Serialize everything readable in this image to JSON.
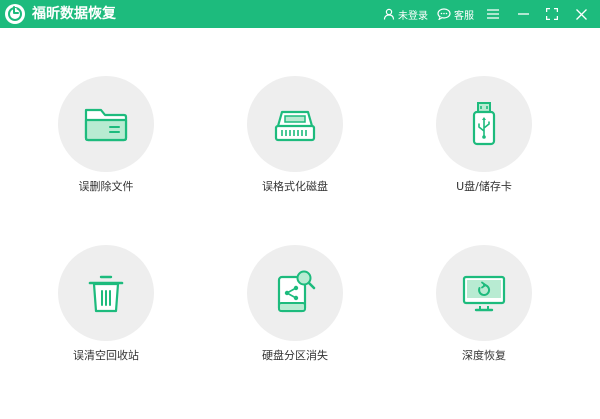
{
  "titlebar": {
    "app_title": "福昕数据恢复",
    "login_label": "未登录",
    "service_label": "客服",
    "icons": [
      "app-logo-icon",
      "user-icon",
      "chat-icon",
      "menu-icon",
      "minimize-icon",
      "maximize-icon",
      "close-icon"
    ]
  },
  "tiles": [
    {
      "label": "误删除文件",
      "icon": "folder-icon"
    },
    {
      "label": "误格式化磁盘",
      "icon": "hard-drive-icon"
    },
    {
      "label": "U盘/储存卡",
      "icon": "usb-icon"
    },
    {
      "label": "误清空回收站",
      "icon": "trash-icon"
    },
    {
      "label": "硬盘分区消失",
      "icon": "disk-search-icon"
    },
    {
      "label": "深度恢复",
      "icon": "monitor-restore-icon"
    }
  ],
  "colors": {
    "accent": "#1dbb7d",
    "icon_fill": "#b8ebd2",
    "circle_bg": "#eeeeee",
    "text": "#333333"
  }
}
